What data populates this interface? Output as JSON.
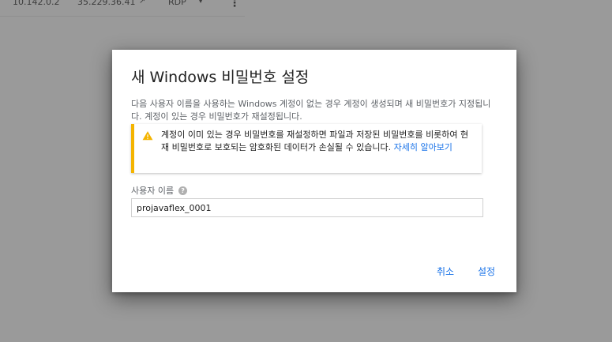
{
  "background": {
    "internal_ip": "10.142.0.2",
    "external_ip": "35.229.36.41",
    "connect_label": "RDP",
    "icons": [
      "external-link-icon",
      "dropdown-arrow-icon",
      "more-vert-icon"
    ]
  },
  "dialog": {
    "title": "새 Windows 비밀번호 설정",
    "description": "다음 사용자 이름을 사용하는 Windows 계정이 없는 경우 계정이 생성되며 새 비밀번호가 지정됩니다. 계정이 있는 경우 비밀번호가 재설정됩니다.",
    "warning": {
      "text": "계정이 이미 있는 경우 비밀번호를 재설정하면 파일과 저장된 비밀번호를 비롯하여 현재 비밀번호로 보호되는 암호화된 데이터가 손실될 수 있습니다.",
      "link": "자세히 알아보기",
      "icon": "warning-icon",
      "accent_color": "#f4b400"
    },
    "username_label": "사용자 이름",
    "username_value": "projavaflex_0001",
    "cancel_label": "취소",
    "set_label": "설정",
    "link_color": "#1a73e8"
  }
}
